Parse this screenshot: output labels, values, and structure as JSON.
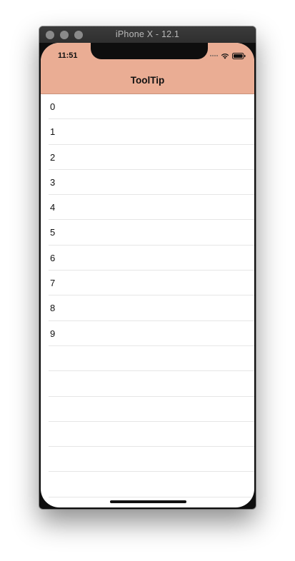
{
  "window": {
    "title": "iPhone X - 12.1"
  },
  "status_bar": {
    "time": "11:51",
    "icons": [
      "signal-dots-icon",
      "wifi-icon",
      "battery-icon"
    ]
  },
  "nav": {
    "title": "ToolTip",
    "background": "#eaad94"
  },
  "table": {
    "rows": [
      "0",
      "1",
      "2",
      "3",
      "4",
      "5",
      "6",
      "7",
      "8",
      "9"
    ],
    "empty_rows": 6
  }
}
